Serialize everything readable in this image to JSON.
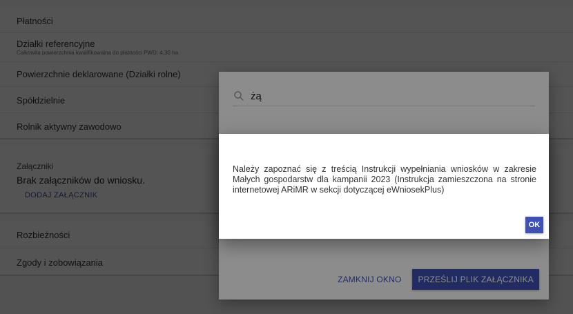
{
  "sections": {
    "payments": "Płatności",
    "reference_plots": {
      "label": "Działki referencyjne",
      "subtitle": "Całkowita powierzchnia kwalifikowalna do płatności PWD: 4,30 ha"
    },
    "declared_areas": "Powierzchnie deklarowane (Działki rolne)",
    "cooperatives": "Spółdzielnie",
    "active_farmer": "Rolnik aktywny zawodowo",
    "attachments": {
      "title": "Załączniki",
      "empty_text": "Brak załączników do wniosku.",
      "add_label": "DODAJ ZAŁĄCZNIK"
    },
    "discrepancies": "Rozbieżności",
    "consents": "Zgody i zobowiązania"
  },
  "attachment_dialog": {
    "search_value": "żą",
    "close_label": "ZAMKNIJ OKNO",
    "upload_label": "PRZEŚLIJ PLIK ZAŁĄCZNIKA"
  },
  "alert_dialog": {
    "message": "Należy zapoznać się z treścią Instrukcji wypełniania wniosków w zakresie Małych gospodarstw dla kampanii 2023 (Instrukcja zamieszczona na stronie internetowej ARiMR w sekcji dotyczącej eWniosekPlus)",
    "ok_label": "OK"
  },
  "colors": {
    "accent": "#3f51b5"
  }
}
